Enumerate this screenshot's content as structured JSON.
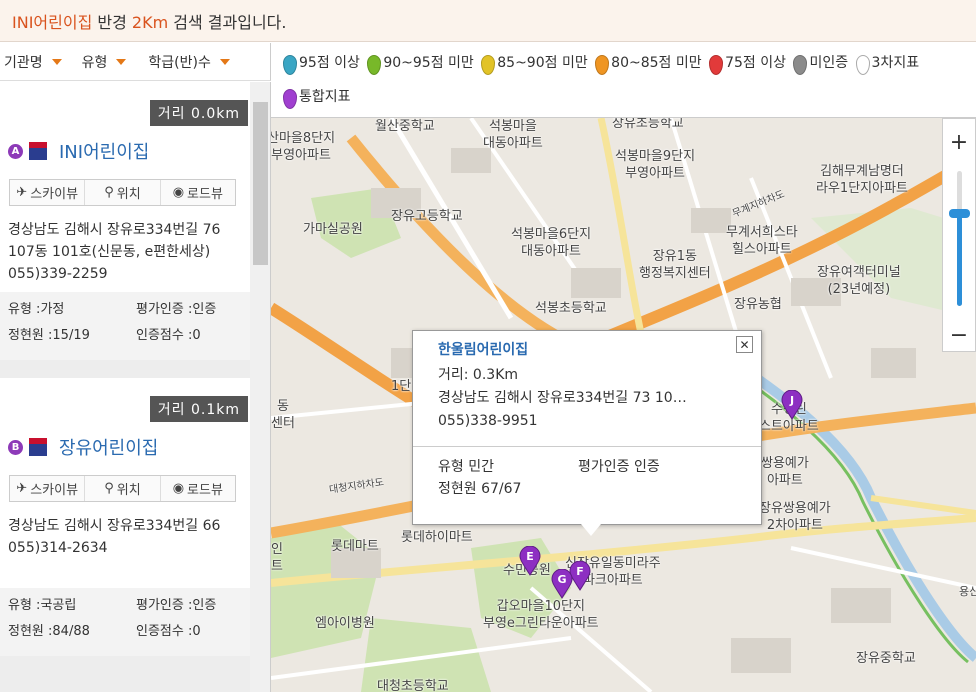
{
  "header": {
    "school": "INI어린이집",
    "mid": " 반경 ",
    "radius": "2Km",
    "rest": " 검색 결과입니다."
  },
  "filters": [
    {
      "label": "기관명"
    },
    {
      "label": "유형"
    },
    {
      "label": "학급(반)수"
    }
  ],
  "legend": [
    {
      "label": "95점 이상",
      "color": "#3aa6c4"
    },
    {
      "label": "90~95점 미만",
      "color": "#78b829"
    },
    {
      "label": "85~90점 미만",
      "color": "#e2c327"
    },
    {
      "label": "80~85점 미만",
      "color": "#ef9522"
    },
    {
      "label": "75점 이상",
      "color": "#e23a3a"
    },
    {
      "label": "미인증",
      "color": "#8b8b8b"
    },
    {
      "label": "3차지표",
      "color": "#ffffff"
    },
    {
      "label": "통합지표",
      "color": "#a03fd0"
    }
  ],
  "results": [
    {
      "letter": "A",
      "distance": "거리 0.0km",
      "name": "INI어린이집",
      "buttons": {
        "sky": "스카이뷰",
        "pos": "위치",
        "road": "로드뷰"
      },
      "address": "경상남도 김해시 장유로334번길 76 107동 101호(신문동, e편한세상)",
      "phone": "055)339-2259",
      "type_label": "유형 :",
      "type": "가정",
      "cert_label": "평가인증 :",
      "cert": "인증",
      "cap_label": "정현원 :",
      "cap": "15/19",
      "score_label": "인증점수 :",
      "score": "0"
    },
    {
      "letter": "B",
      "distance": "거리 0.1km",
      "name": "장유어린이집",
      "buttons": {
        "sky": "스카이뷰",
        "pos": "위치",
        "road": "로드뷰"
      },
      "address": "경상남도 김해시 장유로334번길 66",
      "phone": "055)314-2634",
      "type_label": "유형 :",
      "type": "국공립",
      "cert_label": "평가인증 :",
      "cert": "인증",
      "cap_label": "정현원 :",
      "cap": "84/88",
      "score_label": "인증점수 :",
      "score": "0"
    }
  ],
  "popup": {
    "title": "한울림어린이집",
    "distance": "거리: 0.3Km",
    "address": "경상남도 김해시 장유로334번길 73 10…",
    "phone": "055)338-9951",
    "type": "유형 민간",
    "cert": "평가인증 인증",
    "cap": "정현원 67/67"
  },
  "map": {
    "labels": {
      "l1": "월산중학교",
      "l2": "산마을8단지\n부영아파트",
      "l3": "석봉마을\n대동아파트",
      "l4": "장유초등학교",
      "l5": "석봉마을9단지\n부영아파트",
      "l6": "가마실공원",
      "l7": "장유고등학교",
      "l8": "석봉마을6단지\n대동아파트",
      "l9": "장유1동\n행정복지센터",
      "l10": "무계서희스타\n힐스아파트",
      "l11": "김해무계남명더\n라우1단지아파트",
      "l12": "장유여객터미널\n(23년예정)",
      "l13": "장유농협",
      "l14": "석봉초등학교",
      "l15": "무계지하차도",
      "l16": "동\n센터",
      "l17": "1단",
      "l18": "수경린\n스트아파트",
      "l19": "쌍용예가\n아파트",
      "l20": "장유쌍용예가\n2차아파트",
      "l21": "대청지하차도",
      "l22": "롯데마트",
      "l23": "롯데하이마트",
      "l24": "수민공원",
      "l25": "신장유일동미라주\n파크아파트",
      "l26": "갑오마을10단지\n부영e그린타운아파트",
      "l27": "엠아이병원",
      "l28": "장유중학교",
      "l29": "대청초등학교",
      "l30": "인\n트",
      "l31": "용신"
    },
    "markers": [
      {
        "letter": "J"
      },
      {
        "letter": "E"
      },
      {
        "letter": "F"
      },
      {
        "letter": "G"
      }
    ],
    "zoom_in": "+",
    "zoom_out": "−"
  }
}
